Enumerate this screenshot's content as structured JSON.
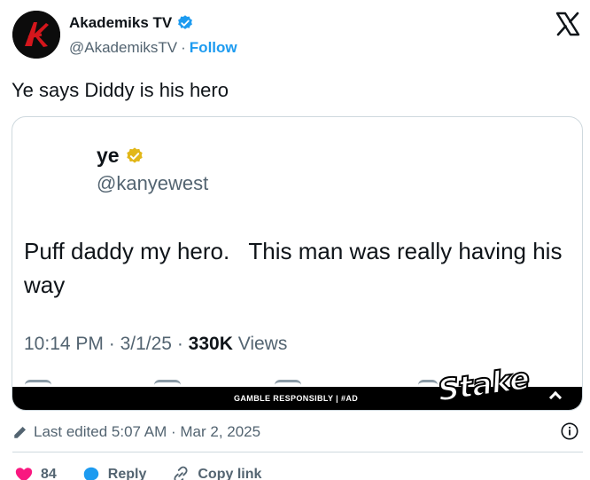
{
  "author": {
    "name": "Akademiks TV",
    "handle": "@AkademiksTV",
    "separator": "·",
    "follow_label": "Follow"
  },
  "tweet": {
    "text": "Ye says Diddy is his hero"
  },
  "embedded": {
    "name": "ye",
    "handle": "@kanyewest",
    "body": "Puff daddy my hero.   This man was really having his way",
    "time": "10:14 PM",
    "date": "3/1/25",
    "views_count": "330K",
    "views_label": "Views",
    "dot": "·"
  },
  "ad": {
    "text": "GAMBLE RESPONSIBLY  |  #AD",
    "brand": "Stake"
  },
  "footer": {
    "edited_text": "Last edited 5:07 AM · Mar 2, 2025"
  },
  "actions": {
    "like_count": "84",
    "reply_label": "Reply",
    "copy_label": "Copy link"
  },
  "colors": {
    "accent": "#1d9bf0",
    "like": "#f91880",
    "gold_badge": "#e2b719"
  },
  "icons": [
    "verified-badge-icon",
    "x-logo-icon",
    "gold-badge-icon",
    "pencil-icon",
    "info-icon",
    "heart-icon",
    "reply-icon",
    "link-icon",
    "chevron-up-icon"
  ]
}
